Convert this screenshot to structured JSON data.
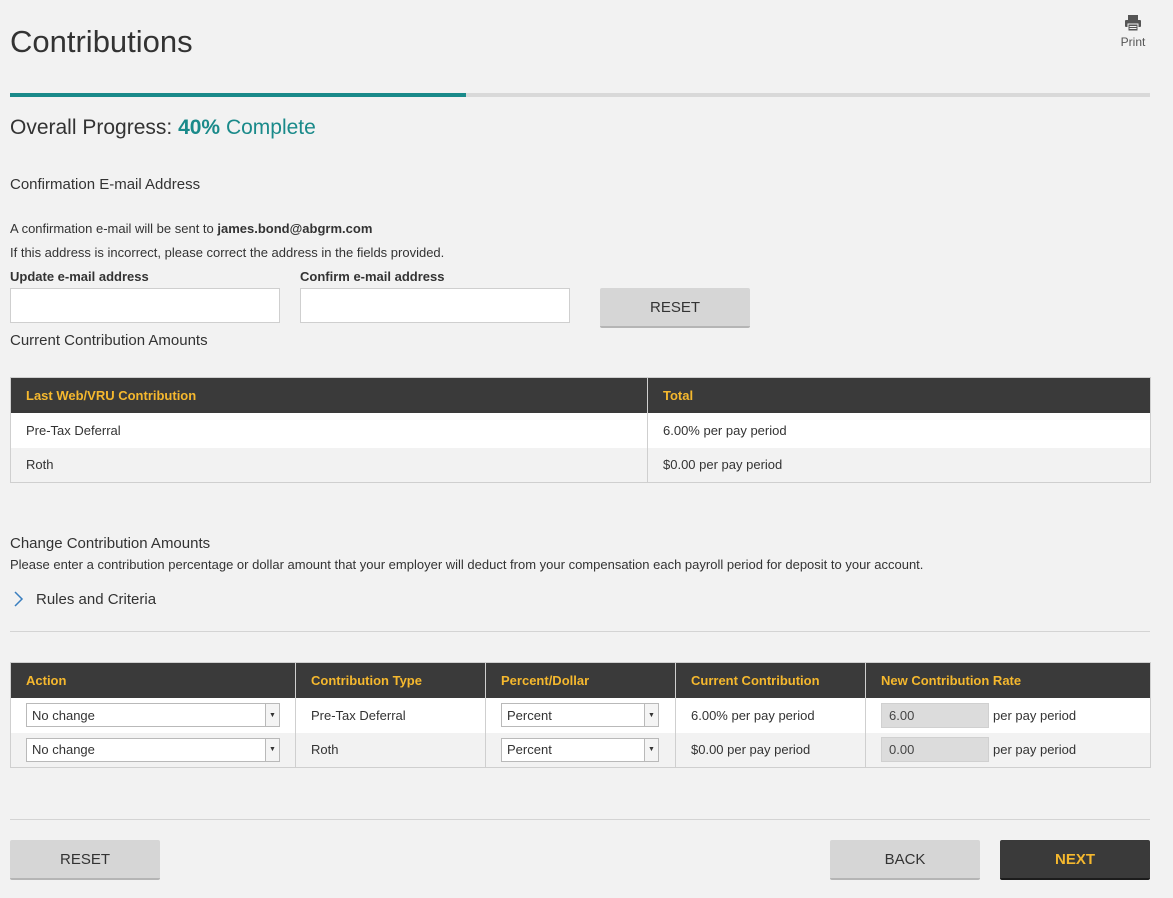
{
  "page": {
    "title": "Contributions",
    "print_label": "Print"
  },
  "progress": {
    "label": "Overall Progress:",
    "percent_text": "40%",
    "complete_text": "Complete",
    "value": 0.4
  },
  "colors": {
    "accent_teal": "#1a8a8a",
    "header_gold": "#f5b82e",
    "header_bg": "#3a3a3a"
  },
  "email": {
    "section_title": "Confirmation E-mail Address",
    "sent_prefix": "A confirmation e-mail will be sent to",
    "address": "james.bond@abgrm.com",
    "instruction": "If this address is incorrect, please correct the address in the fields provided.",
    "update_label": "Update e-mail address",
    "confirm_label": "Confirm e-mail address",
    "update_value": "",
    "confirm_value": "",
    "reset_label": "RESET"
  },
  "current": {
    "section_title": "Current Contribution Amounts",
    "headers": [
      "Last Web/VRU Contribution",
      "Total"
    ],
    "rows": [
      {
        "type": "Pre-Tax Deferral",
        "total": "6.00% per pay period"
      },
      {
        "type": "Roth",
        "total": "$0.00 per pay period"
      }
    ]
  },
  "change": {
    "section_title": "Change Contribution Amounts",
    "description": "Please enter a contribution percentage or dollar amount that your employer will deduct from your compensation each payroll period for deposit to your account.",
    "rules_label": "Rules and Criteria",
    "headers": [
      "Action",
      "Contribution Type",
      "Percent/Dollar",
      "Current Contribution",
      "New Contribution Rate"
    ],
    "rows": [
      {
        "action": "No change",
        "type": "Pre-Tax Deferral",
        "mode": "Percent",
        "current": "6.00% per pay period",
        "rate": "6.00",
        "unit": "per pay period"
      },
      {
        "action": "No change",
        "type": "Roth",
        "mode": "Percent",
        "current": "$0.00 per pay period",
        "rate": "0.00",
        "unit": "per pay period"
      }
    ]
  },
  "footer": {
    "reset_label": "RESET",
    "back_label": "BACK",
    "next_label": "NEXT"
  }
}
